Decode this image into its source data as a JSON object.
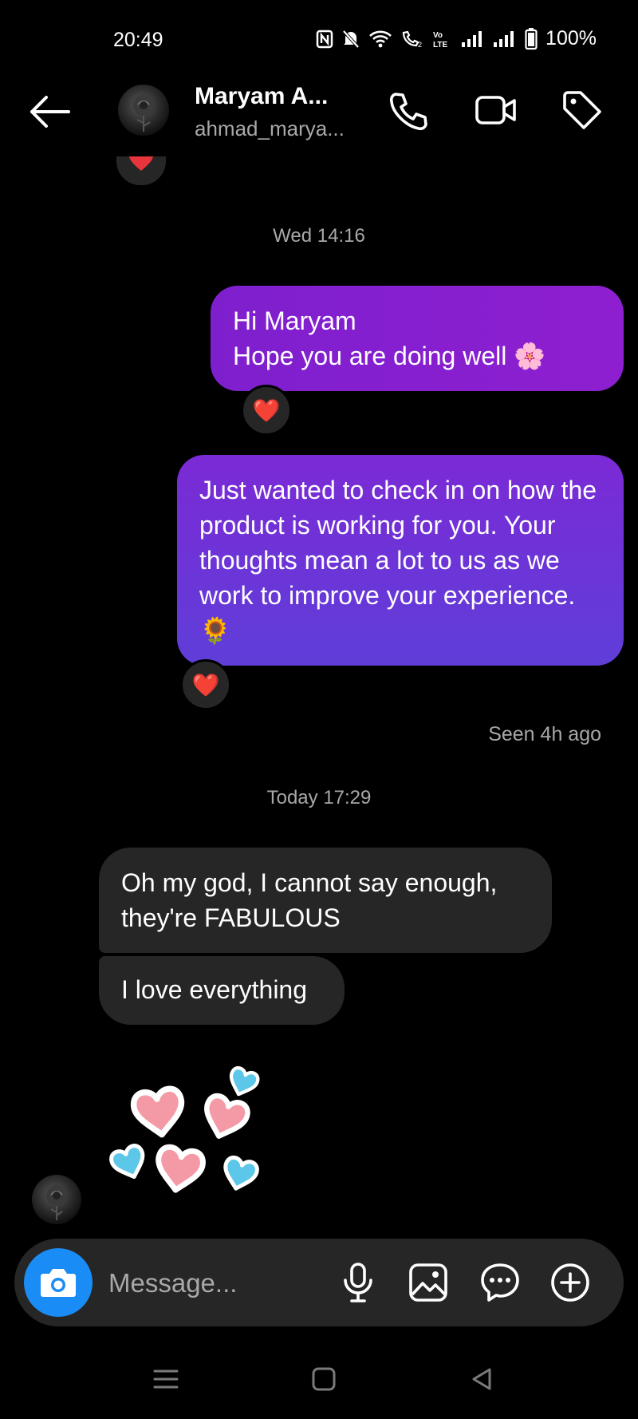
{
  "status_bar": {
    "time": "20:49",
    "battery": "100%",
    "icons": [
      "nfc-icon",
      "mute-icon",
      "wifi-icon",
      "wifi-call-icon",
      "volte-icon",
      "signal-icon",
      "signal-icon",
      "battery-icon"
    ]
  },
  "header": {
    "contact_name": "Maryam A...",
    "username": "ahmad_marya...",
    "icons": [
      "back-arrow-icon",
      "phone-icon",
      "video-camera-icon",
      "tag-icon"
    ]
  },
  "chat": {
    "timestamp_1": "Wed 14:16",
    "outgoing_1": "Hi Maryam\nHope you are doing well 🌸",
    "outgoing_1_reaction": "❤️",
    "outgoing_2": "Just wanted to check in on how the product is working for you. Your thoughts mean a lot to us as we work to improve your experience. 🌻",
    "outgoing_2_reaction": "❤️",
    "seen": "Seen 4h ago",
    "timestamp_2": "Today 17:29",
    "incoming_1": "Oh my god, I cannot say enough, they're FABULOUS",
    "incoming_2": "I love everything",
    "sticker": "hearts-sticker"
  },
  "composer": {
    "placeholder": "Message...",
    "icons": [
      "camera-icon",
      "microphone-icon",
      "gallery-icon",
      "sticker-icon",
      "plus-icon"
    ]
  },
  "nav_bar": {
    "icons": [
      "menu-icon",
      "home-icon",
      "back-icon"
    ]
  },
  "colors": {
    "background": "#000000",
    "outgoing_bubble_top": "#8e1fd0",
    "outgoing_bubble_bottom": "#5f3ed8",
    "incoming_bubble": "#262626",
    "camera_button": "#1a8cf5",
    "muted_text": "#a8a8a8"
  }
}
